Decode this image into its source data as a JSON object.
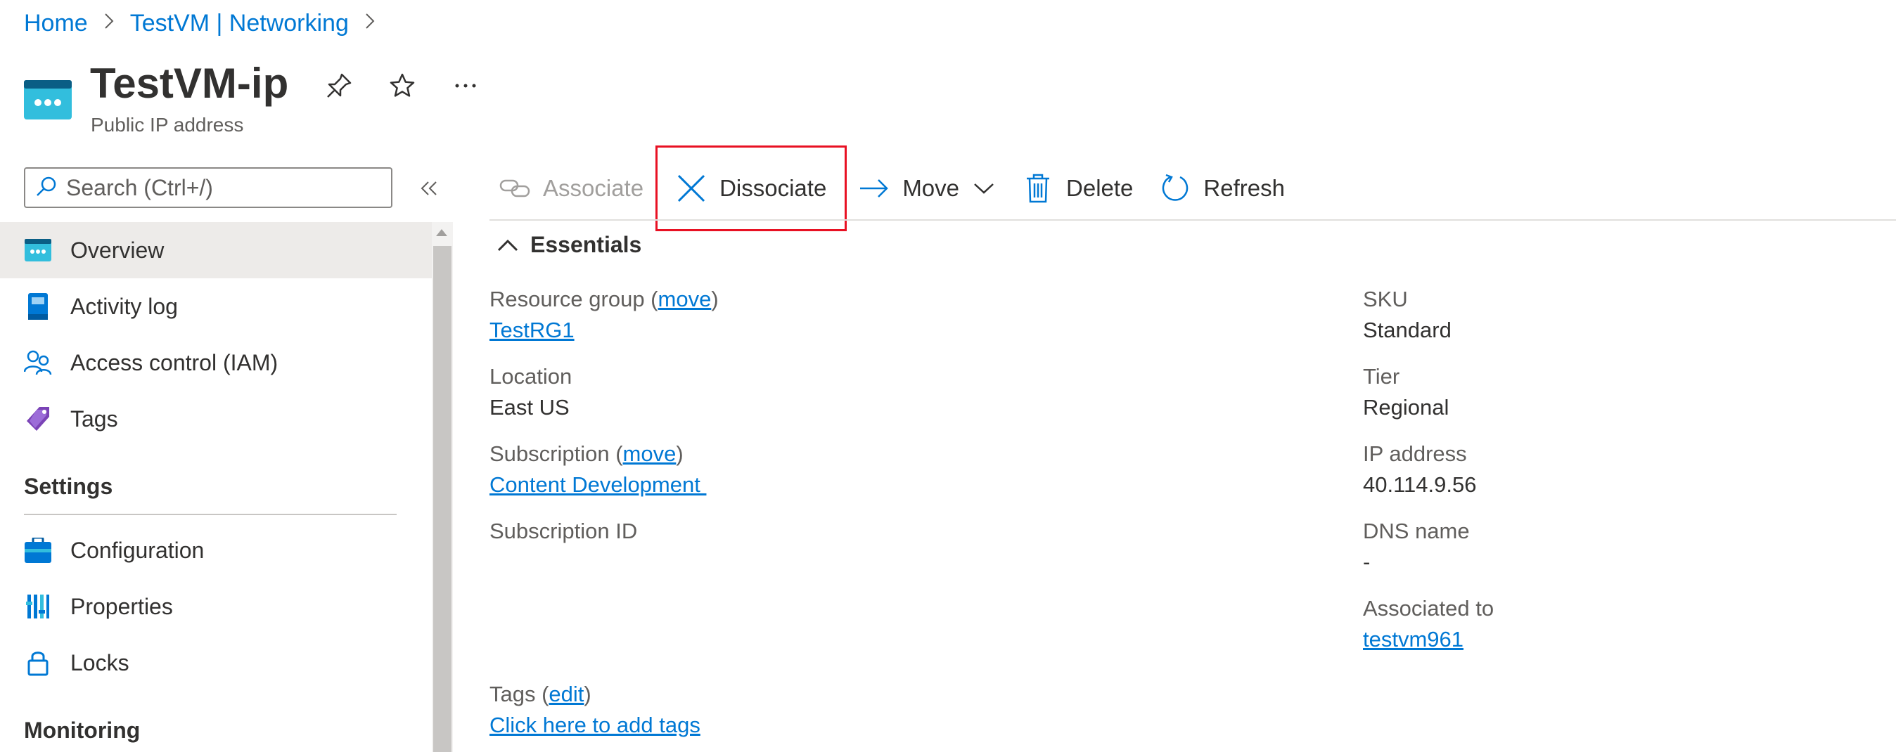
{
  "breadcrumb": {
    "home": "Home",
    "parent": "TestVM | Networking"
  },
  "header": {
    "title": "TestVM-ip",
    "subtitle": "Public IP address"
  },
  "search": {
    "placeholder": "Search (Ctrl+/)"
  },
  "nav": {
    "items": [
      {
        "label": "Overview"
      },
      {
        "label": "Activity log"
      },
      {
        "label": "Access control (IAM)"
      },
      {
        "label": "Tags"
      }
    ],
    "settings_heading": "Settings",
    "settings_items": [
      {
        "label": "Configuration"
      },
      {
        "label": "Properties"
      },
      {
        "label": "Locks"
      }
    ],
    "monitoring_heading": "Monitoring"
  },
  "toolbar": {
    "associate": "Associate",
    "dissociate": "Dissociate",
    "move": "Move",
    "delete": "Delete",
    "refresh": "Refresh"
  },
  "essentials": {
    "heading": "Essentials",
    "resource_group": {
      "label": "Resource group (",
      "link": "move",
      "close": ")",
      "value": "TestRG1"
    },
    "location": {
      "label": "Location",
      "value": "East US"
    },
    "subscription": {
      "label": "Subscription (",
      "link": "move",
      "close": ")",
      "value": "Content Development "
    },
    "subscription_id": {
      "label": "Subscription ID"
    },
    "sku": {
      "label": "SKU",
      "value": "Standard"
    },
    "tier": {
      "label": "Tier",
      "value": "Regional"
    },
    "ip_address": {
      "label": "IP address",
      "value": "40.114.9.56"
    },
    "dns_name": {
      "label": "DNS name",
      "value": "-"
    },
    "associated_to": {
      "label": "Associated to",
      "value": "testvm961"
    },
    "tags": {
      "label": "Tags (",
      "link": "edit",
      "close": ")",
      "value": "Click here to add tags"
    }
  },
  "colors": {
    "accent": "#0078d4",
    "highlight": "#e81123",
    "active_bg": "#edebe9"
  }
}
